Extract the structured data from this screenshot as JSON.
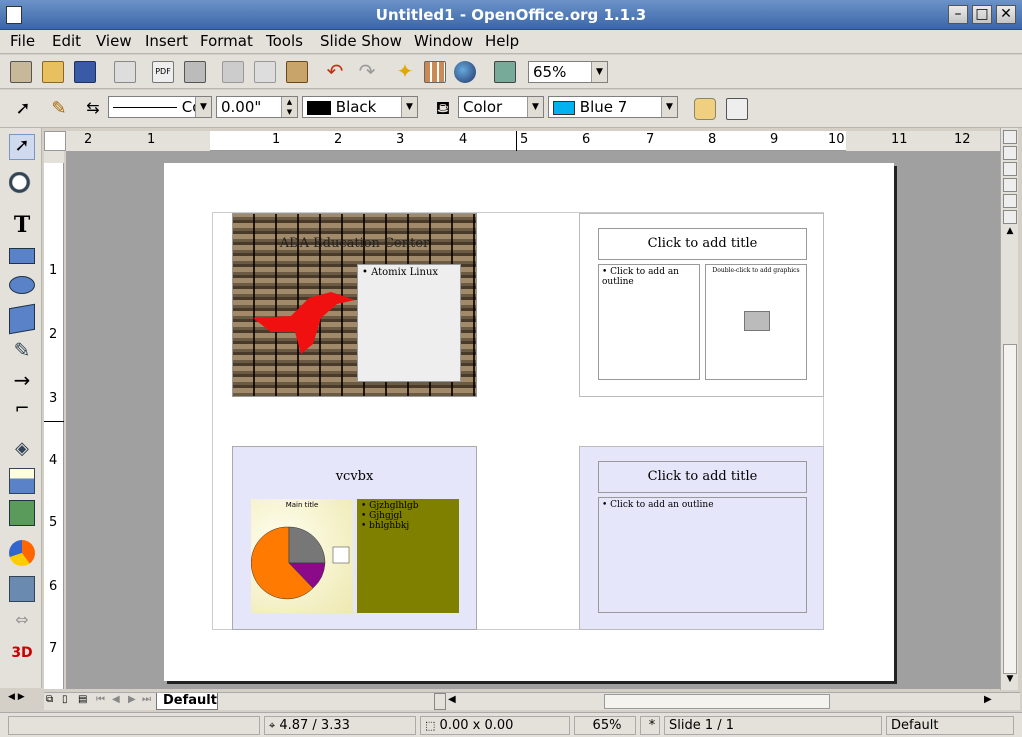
{
  "window": {
    "title": "Untitled1 - OpenOffice.org 1.1.3"
  },
  "menu": [
    "File",
    "Edit",
    "View",
    "Insert",
    "Format",
    "Tools",
    "Slide Show",
    "Window",
    "Help"
  ],
  "toolbar1": {
    "zoom_value": "65%"
  },
  "toolbar2": {
    "line_style": "Co",
    "line_width": "0.00\"",
    "line_color": "Black",
    "area_style": "Color",
    "area_color": "Blue 7",
    "line_color_hex": "#000000",
    "area_color_hex": "#00b2f0"
  },
  "hruler_labels": [
    "2",
    "1",
    "1",
    "2",
    "3",
    "4",
    "5",
    "6",
    "7",
    "8",
    "9",
    "10",
    "11",
    "12"
  ],
  "vruler_labels": [
    "1",
    "2",
    "3",
    "4",
    "5",
    "6",
    "7"
  ],
  "slides": {
    "s1": {
      "title": "ADA Education Center",
      "bullet": "Atomix Linux"
    },
    "s2": {
      "title": "Click to add title",
      "outline": "Click to add an outline",
      "graphic": "Double-click to add graphics"
    },
    "s3": {
      "title": "vcvbx",
      "chart_title": "Main title",
      "bullets": [
        "Gjzhglhlgb",
        "Gjhgjgl",
        "bhlghbkj"
      ]
    },
    "s4": {
      "title": "Click to add title",
      "outline": "Click to add an outline"
    }
  },
  "tabs": {
    "active": "Default"
  },
  "status": {
    "position": "4.87 / 3.33",
    "size": "0.00 x 0.00",
    "zoom": "65%",
    "modified": "*",
    "slide": "Slide 1 / 1",
    "layout": "Default"
  }
}
